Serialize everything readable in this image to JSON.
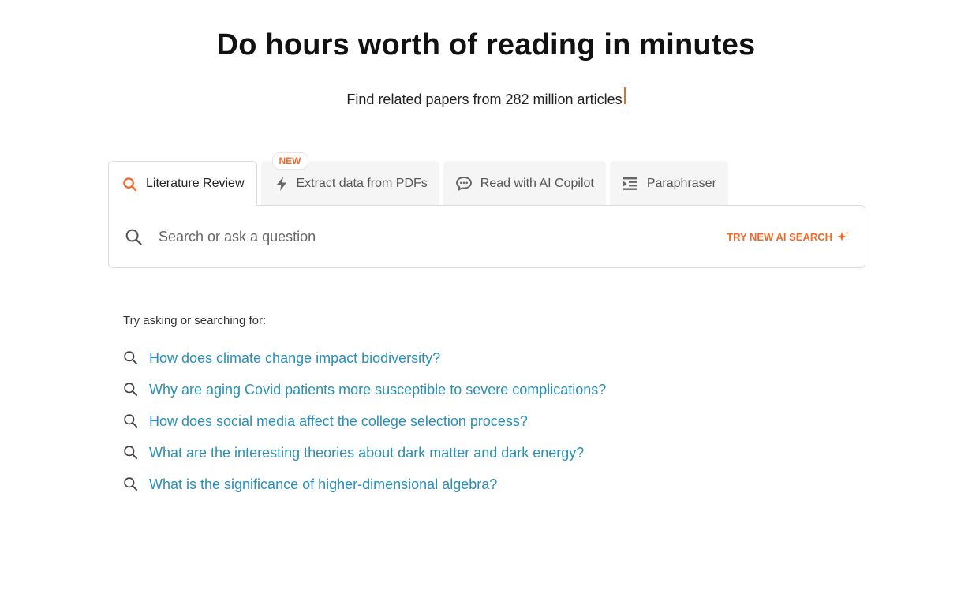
{
  "hero": {
    "title": "Do hours worth of reading in minutes",
    "subtitle": "Find related papers from 282 million articles"
  },
  "tabs": [
    {
      "label": "Literature Review",
      "icon": "search-icon",
      "active": true
    },
    {
      "label": "Extract data from PDFs",
      "icon": "lightning-icon",
      "badge": "NEW"
    },
    {
      "label": "Read with AI Copilot",
      "icon": "chat-icon"
    },
    {
      "label": "Paraphraser",
      "icon": "indent-icon"
    }
  ],
  "search": {
    "placeholder": "Search or ask a question",
    "value": "",
    "ai_search_label": "TRY NEW AI SEARCH"
  },
  "suggestions": {
    "label": "Try asking or searching for:",
    "items": [
      "How does climate change impact biodiversity?",
      "Why are aging Covid patients more susceptible to severe complications?",
      "How does social media affect the college selection process?",
      "What are the interesting theories about dark matter and dark energy?",
      "What is the significance of higher-dimensional algebra?"
    ]
  },
  "colors": {
    "accent": "#f26a2a",
    "link": "#2b8fb5",
    "text": "#111111",
    "border": "#dcdcdc"
  }
}
